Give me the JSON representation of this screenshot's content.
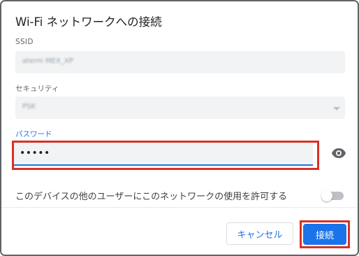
{
  "dialog": {
    "title": "Wi-Fi ネットワークへの接続"
  },
  "ssid": {
    "label": "SSID",
    "value": "aterm MEX_XP"
  },
  "security": {
    "label": "セキュリティ",
    "value": "PSK"
  },
  "password": {
    "label": "パスワード",
    "value": "•••••",
    "toggle_icon": "eye-icon"
  },
  "share": {
    "label": "このデバイスの他のユーザーにこのネットワークの使用を許可する",
    "enabled": false
  },
  "buttons": {
    "cancel": "キャンセル",
    "connect": "接続"
  },
  "colors": {
    "accent": "#1a73e8",
    "highlight": "#d93025"
  }
}
